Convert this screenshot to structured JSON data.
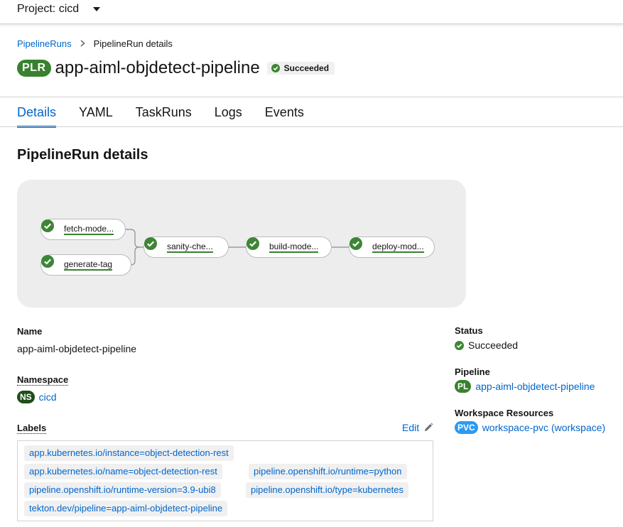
{
  "topbar": {
    "project_label": "Project: cicd"
  },
  "breadcrumb": {
    "parent": "PipelineRuns",
    "current": "PipelineRun details"
  },
  "header": {
    "badge": "PLR",
    "title": "app-aiml-objdetect-pipeline",
    "status": "Succeeded"
  },
  "tabs": [
    {
      "label": "Details",
      "active": true
    },
    {
      "label": "YAML",
      "active": false
    },
    {
      "label": "TaskRuns",
      "active": false
    },
    {
      "label": "Logs",
      "active": false
    },
    {
      "label": "Events",
      "active": false
    }
  ],
  "section_title": "PipelineRun details",
  "graph": {
    "nodes": [
      {
        "label": "fetch-mode...",
        "status": "succeeded"
      },
      {
        "label": "generate-tag",
        "status": "succeeded"
      },
      {
        "label": "sanity-che...",
        "status": "succeeded"
      },
      {
        "label": "build-mode...",
        "status": "succeeded"
      },
      {
        "label": "deploy-mod...",
        "status": "succeeded"
      }
    ]
  },
  "details": {
    "name_label": "Name",
    "name_value": "app-aiml-objdetect-pipeline",
    "namespace_label": "Namespace",
    "namespace_badge": "NS",
    "namespace_value": "cicd",
    "labels_label": "Labels",
    "edit_label": "Edit",
    "labels": [
      "app.kubernetes.io/instance=object-detection-rest",
      "app.kubernetes.io/name=object-detection-rest",
      "pipeline.openshift.io/runtime=python",
      "pipeline.openshift.io/runtime-version=3.9-ubi8",
      "pipeline.openshift.io/type=kubernetes",
      "tekton.dev/pipeline=app-aiml-objdetect-pipeline"
    ]
  },
  "side": {
    "status_label": "Status",
    "status_value": "Succeeded",
    "pipeline_label": "Pipeline",
    "pipeline_badge": "PL",
    "pipeline_value": "app-aiml-objdetect-pipeline",
    "workspace_label": "Workspace Resources",
    "workspace_badge": "PVC",
    "workspace_value": "workspace-pvc (workspace)"
  },
  "colors": {
    "success": "#3e8635",
    "link": "#0066cc",
    "graph_bg": "#ededed"
  }
}
